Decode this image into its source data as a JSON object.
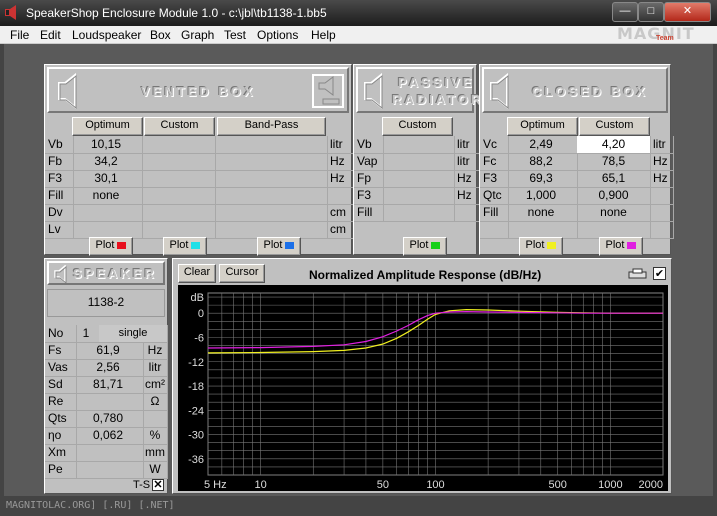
{
  "window": {
    "title": "SpeakerShop Enclosure Module 1.0 - c:\\jbl\\tb1138-1.bb5",
    "minimize": "—",
    "maximize": "□",
    "close": "✕"
  },
  "logo": {
    "text": "MAGNIT LA",
    "sub": "Team"
  },
  "menu": [
    "File",
    "Edit",
    "Loudspeaker",
    "Box",
    "Graph",
    "Test",
    "Options",
    "Help"
  ],
  "vented": {
    "title": "VENTED BOX",
    "columns": [
      "Optimum",
      "Custom",
      "Band-Pass"
    ],
    "rows": [
      {
        "label": "Vb",
        "values": [
          "10,15",
          "",
          ""
        ],
        "unit": "litr"
      },
      {
        "label": "Fb",
        "values": [
          "34,2",
          "",
          ""
        ],
        "unit": "Hz"
      },
      {
        "label": "F3",
        "values": [
          "30,1",
          "",
          ""
        ],
        "unit": "Hz"
      },
      {
        "label": "Fill",
        "values": [
          "none",
          "",
          ""
        ],
        "unit": ""
      },
      {
        "label": "Dv",
        "values": [
          "",
          "",
          ""
        ],
        "unit": "cm"
      },
      {
        "label": "Lv",
        "values": [
          "",
          "",
          ""
        ],
        "unit": "cm"
      }
    ],
    "plot_label": "Plot",
    "plot_colors": [
      "#e8101c",
      "#20e0e8",
      "#1c70e8"
    ]
  },
  "passive": {
    "title_1": "PASSIVE",
    "title_2": "RADIATOR",
    "column": "Custom",
    "rows": [
      {
        "label": "Vb",
        "unit": "litr"
      },
      {
        "label": "Vap",
        "unit": "litr"
      },
      {
        "label": "Fp",
        "unit": "Hz"
      },
      {
        "label": "F3",
        "unit": "Hz"
      },
      {
        "label": "Fill",
        "unit": ""
      }
    ],
    "plot_label": "Plot",
    "plot_color": "#18d018"
  },
  "closed": {
    "title": "CLOSED BOX",
    "columns": [
      "Optimum",
      "Custom"
    ],
    "rows": [
      {
        "label": "Vc",
        "values": [
          "2,49",
          "4,20"
        ],
        "unit": "litr"
      },
      {
        "label": "Fc",
        "values": [
          "88,2",
          "78,5"
        ],
        "unit": "Hz"
      },
      {
        "label": "F3",
        "values": [
          "69,3",
          "65,1"
        ],
        "unit": "Hz"
      },
      {
        "label": "Qtc",
        "values": [
          "1,000",
          "0,900"
        ],
        "unit": ""
      },
      {
        "label": "Fill",
        "values": [
          "none",
          "none"
        ],
        "unit": ""
      }
    ],
    "plot_label": "Plot",
    "plot_colors": [
      "#f0f020",
      "#e020e0"
    ]
  },
  "speaker": {
    "title": "SPEAKER",
    "model": "1138-2",
    "no_label": "No",
    "no_value": "1",
    "config": "single",
    "params": [
      {
        "label": "Fs",
        "value": "61,9",
        "unit": "Hz"
      },
      {
        "label": "Vas",
        "value": "2,56",
        "unit": "litr"
      },
      {
        "label": "Sd",
        "value": "81,71",
        "unit": "cm²"
      },
      {
        "label": "Re",
        "value": "",
        "unit": "Ω"
      },
      {
        "label": "Qts",
        "value": "0,780",
        "unit": ""
      },
      {
        "label": "ηo",
        "value": "0,062",
        "unit": "%"
      },
      {
        "label": "Xm",
        "value": "",
        "unit": "mm"
      },
      {
        "label": "Pe",
        "value": "",
        "unit": "W"
      }
    ],
    "ts_label": "T-S"
  },
  "graph": {
    "clear_label": "Clear",
    "cursor_label": "Cursor",
    "title": "Normalized Amplitude Response (dB/Hz)",
    "checkbox": "✔"
  },
  "chart_data": {
    "type": "line",
    "title": "Normalized Amplitude Response (dB/Hz)",
    "xlabel": "",
    "ylabel": "dB",
    "x_scale": "log",
    "xlim": [
      5,
      2000
    ],
    "ylim": [
      -40,
      5
    ],
    "x_tick_labels": [
      {
        "v": 5,
        "t": "5 Hz"
      },
      {
        "v": 10,
        "t": "10"
      },
      {
        "v": 50,
        "t": "50"
      },
      {
        "v": 100,
        "t": "100"
      },
      {
        "v": 500,
        "t": "500"
      },
      {
        "v": 1000,
        "t": "1000"
      },
      {
        "v": 2000,
        "t": "2000"
      }
    ],
    "y_tick_labels": [
      {
        "v": 4,
        "t": "dB"
      },
      {
        "v": 0,
        "t": "0"
      },
      {
        "v": -6,
        "t": "-6"
      },
      {
        "v": -12,
        "t": "-12"
      },
      {
        "v": -18,
        "t": "-18"
      },
      {
        "v": -24,
        "t": "-24"
      },
      {
        "v": -30,
        "t": "-30"
      },
      {
        "v": -36,
        "t": "-36"
      }
    ],
    "grid": true,
    "series": [
      {
        "color": "#f0f020",
        "x": [
          5,
          10,
          20,
          30,
          40,
          50,
          60,
          70,
          80,
          90,
          100,
          120,
          150,
          200,
          300,
          500,
          700,
          1000,
          2000
        ],
        "y": [
          -9.8,
          -9.7,
          -9.5,
          -9.2,
          -8.6,
          -7.6,
          -6.2,
          -4.6,
          -3.0,
          -1.5,
          -0.3,
          0.6,
          0.9,
          0.8,
          0.5,
          0.2,
          0.1,
          0.0,
          0.0
        ]
      },
      {
        "color": "#e020e0",
        "x": [
          5,
          10,
          20,
          30,
          40,
          50,
          60,
          70,
          80,
          90,
          100,
          120,
          150,
          200,
          300,
          500,
          700,
          1000,
          2000
        ],
        "y": [
          -8.6,
          -8.5,
          -8.2,
          -7.8,
          -7.0,
          -5.8,
          -4.4,
          -3.0,
          -1.6,
          -0.6,
          0.0,
          0.3,
          0.4,
          0.3,
          0.2,
          0.1,
          0.0,
          0.0,
          0.0
        ]
      }
    ]
  },
  "status": "MAGNITOLAC.ORG] [.RU] [.NET]"
}
